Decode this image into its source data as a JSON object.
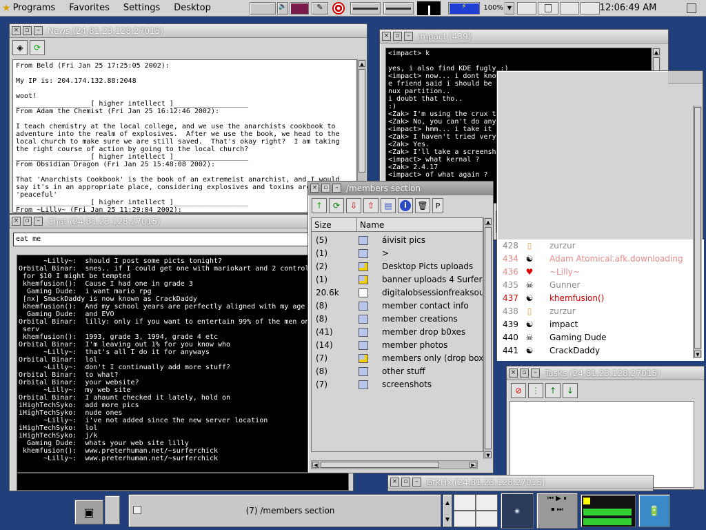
{
  "topbar": {
    "menus": [
      "Programs",
      "Favorites",
      "Settings",
      "Desktop"
    ],
    "zoom": "100%",
    "clock": "12:06:49 AM"
  },
  "news": {
    "title": "News (24.81.23.128:27015)",
    "lines": [
      "From Beld (Fri Jan 25 17:25:05 2002):",
      "",
      "My IP is: 204.174.132.88:2048",
      "",
      "woot!",
      "__________________[ higher intellect ]__________________",
      "From Adam the Chemist (Fri Jan 25 16:12:46 2002):",
      "",
      "I teach chemistry at the local college, and we use the anarchists cookbook to",
      "adventure into the realm of explosives.  After we use the book, we head to the",
      "local church to make sure we are still saved.  That's okay right?  I am taking",
      "the right course of action by going to the local church?",
      "__________________[ higher intellect ]__________________",
      "From Obsidian Dragon (Fri Jan 25 15:48:08 2002):",
      "",
      "That 'Anarchists Cookbook' is the book of an extremeist anarchist, and I would",
      "say it's in an appropriate place, considering explosives and toxins are",
      "'peaceful'",
      "__________________[ higher intellect ]__________________",
      "From ~Lilly~ (Fri Jan 25 11:29:04 2002):"
    ]
  },
  "chat": {
    "title": "Chat (24.81.23.128:27015)",
    "input_value": "eat me",
    "lines": [
      "      ~Lilly~:  should I post some picts tonight?",
      "Orbital Binar:  snes.. if I could get one with mariokart and 2 controllers",
      " for $10 I might be tempted",
      " khemfusion():  Cause I had one in grade 3",
      "  Gaming Dude:  i want mario rpg",
      " [nx] SmackDaddy is now known as CrackDaddy",
      " khemfusion():  And my school years are perfectly aligned with my age",
      "  Gaming Dude:  and EVO",
      "Orbital Binar:  lilly: only if you want to entertain 99% of the men on the",
      " serv",
      " khemfusion():  1993, grade 3, 1994, grade 4 etc",
      "Orbital Binar:  I'm leaving out 1% for you know who",
      "      ~Lilly~:  that's all I do it for anyways",
      "Orbital Binar:  lol",
      "      ~Lilly~:  don't I continually add more stuff?",
      "Orbital Binar:  to what?",
      "Orbital Binar:  your website?",
      "      ~Lilly~:  my web site",
      "Orbital Binar:  I ahaunt checked it lately, hold on",
      "iHighTechSyko:  add more pics",
      "iHighTechSyko:  nude ones",
      "      ~Lilly~:  i've not added since the new server location",
      "iHighTechSyko:  lol",
      "iHighTechSyko:  j/k",
      "  Gaming Dude:  whats your web site lilly",
      " khemfusion():  www.preterhuman.net/~surferchick",
      "      ~Lilly~:  www.preterhuman.net/~surferchick"
    ]
  },
  "impact": {
    "title": "impact (439)",
    "lines": [
      "<impact> k",
      "",
      "yes, i also find KDE fugly :)",
      "<impact> now... i dont know if this is true or not... but my on",
      "e friend said i should be able to install a macos just on my li",
      "nux partition..",
      "i doubt that tho..",
      ":)",
      "<Zak> I'm using the crux theme with OSX-style buttons",
      "<Zak> No, you can't do anything like that.",
      "<impact> hmm... i take it you are running linux aswell ?",
      "<Zak> I haven't tried very hard to find an aqua theme",
      "<Zak> Yes.",
      "<Zak> I'll take a screenshot and upload it.",
      "<impact> what kernal ?",
      "<Zak> 2.4.17",
      "<impact> of what again ?"
    ]
  },
  "members": {
    "title": "/members section",
    "col_size": "Size",
    "col_name": "Name",
    "rows": [
      {
        "size": "(5)",
        "name": "áivisit pics",
        "icon": "folder"
      },
      {
        "size": "(1)",
        "name": ">",
        "icon": "folder"
      },
      {
        "size": "(2)",
        "name": "Desktop Picts uploads",
        "icon": "upload-folder"
      },
      {
        "size": "(1)",
        "name": "banner uploads 4 SurferC",
        "icon": "upload-folder"
      },
      {
        "size": "20.6k",
        "name": "digitalobsessionfreaksout.",
        "icon": "file"
      },
      {
        "size": "(8)",
        "name": "member contact info",
        "icon": "folder"
      },
      {
        "size": "(8)",
        "name": "member creations",
        "icon": "folder"
      },
      {
        "size": "(41)",
        "name": "member drop b0xes",
        "icon": "folder"
      },
      {
        "size": "(14)",
        "name": "member photos",
        "icon": "folder"
      },
      {
        "size": "(7)",
        "name": "members only (drop box)",
        "icon": "upload-folder"
      },
      {
        "size": "(8)",
        "name": "other stuff",
        "icon": "folder"
      },
      {
        "size": "(7)",
        "name": "screenshots",
        "icon": "folder"
      }
    ],
    "toolbar_last": "P"
  },
  "users": {
    "rows": [
      {
        "num": "428",
        "name": "zurzur",
        "icon": "file-icon",
        "color": "#8a8a8a"
      },
      {
        "num": "434",
        "name": "Adam Atomical.afk.downloading",
        "icon": "yinyang-icon",
        "color": "#e88a8a"
      },
      {
        "num": "436",
        "name": "~Lilly~",
        "icon": "heart-icon",
        "color": "#e88a8a"
      },
      {
        "num": "435",
        "name": "Gunner",
        "icon": "skull-icon",
        "color": "#8a8a8a"
      },
      {
        "num": "437",
        "name": "khemfusion()",
        "icon": "yinyang-icon",
        "color": "#d20000"
      },
      {
        "num": "438",
        "name": "zurzur",
        "icon": "file-icon",
        "color": "#8a8a8a"
      },
      {
        "num": "439",
        "name": "impact",
        "icon": "yinyang-icon",
        "color": "#000000"
      },
      {
        "num": "440",
        "name": "Gaming Dude",
        "icon": "skull-icon",
        "color": "#000000"
      },
      {
        "num": "441",
        "name": "CrackDaddy",
        "icon": "yinyang-icon",
        "color": "#000000"
      }
    ]
  },
  "tasks": {
    "title": "Tasks (24.81.23.128:27015)"
  },
  "gtkhx": {
    "title": "GtkHx (24.81.23.128:27015)"
  },
  "taskbar": {
    "active_task": "(7) /members section"
  }
}
